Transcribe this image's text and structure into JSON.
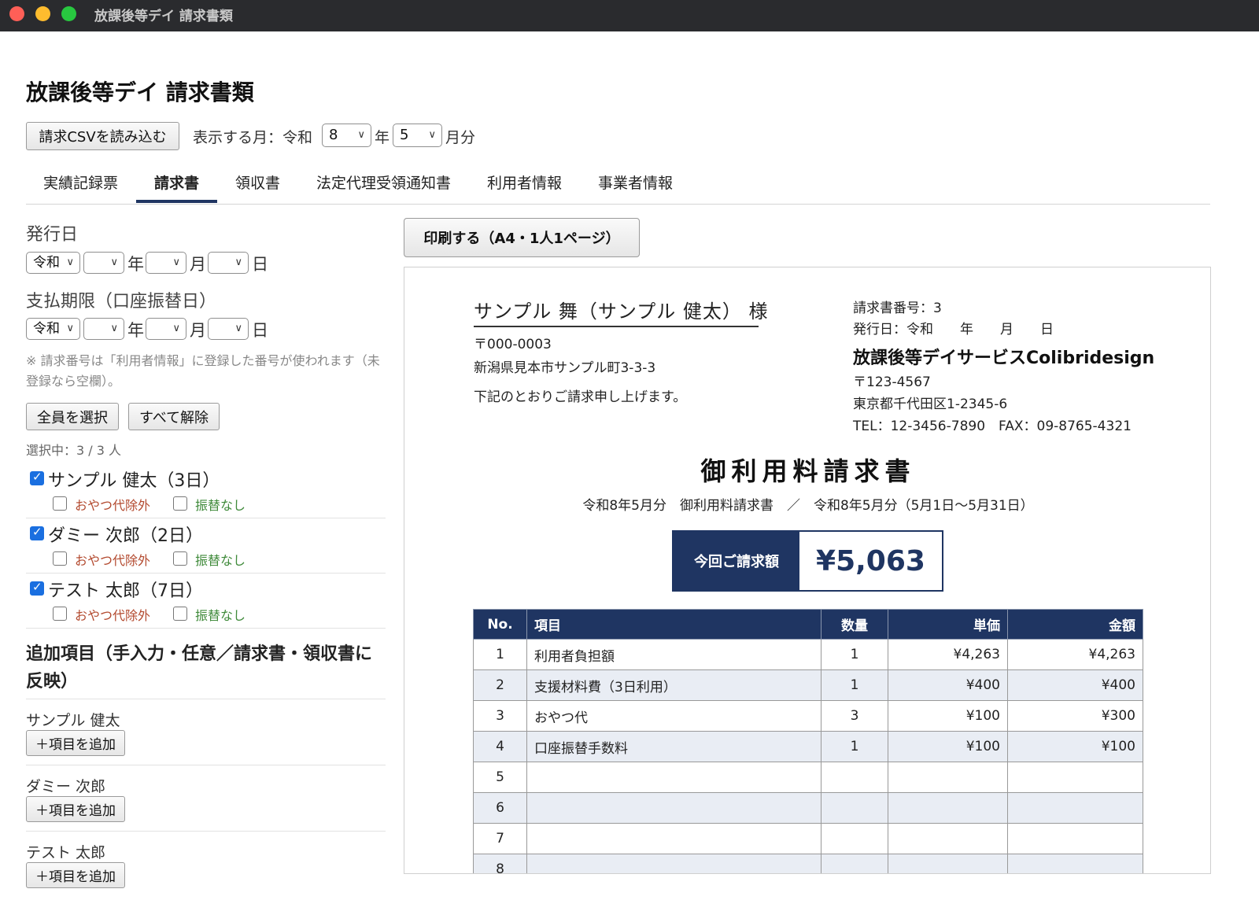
{
  "window": {
    "title": "放課後等デイ 請求書類"
  },
  "page": {
    "title": "放課後等デイ 請求書類"
  },
  "toolbar": {
    "csv_button": "請求CSVを読み込む",
    "month_label_pre": "表示する月：令和",
    "year_value": "8",
    "year_suffix": "年",
    "month_value": "5",
    "month_suffix": "月分"
  },
  "tabs": [
    "実績記録票",
    "請求書",
    "領収書",
    "法定代理受領通知書",
    "利用者情報",
    "事業者情報"
  ],
  "active_tab": "請求書",
  "issue_date": {
    "label": "発行日",
    "era": "令和",
    "year": "",
    "month": "",
    "day": "",
    "year_unit": "年",
    "month_unit": "月",
    "day_unit": "日"
  },
  "due_date": {
    "label": "支払期限（口座振替日）",
    "era": "令和",
    "year": "",
    "month": "",
    "day": "",
    "year_unit": "年",
    "month_unit": "月",
    "day_unit": "日"
  },
  "note": "※ 請求番号は「利用者情報」に登録した番号が使われます（未登録なら空欄）。",
  "select_all_button": "全員を選択",
  "deselect_all_button": "すべて解除",
  "selection_status": "選択中：3 / 3 人",
  "persons": [
    {
      "name": "サンプル 健太（3日）",
      "checked": true,
      "opt1": "おやつ代除外",
      "opt2": "振替なし"
    },
    {
      "name": "ダミー 次郎（2日）",
      "checked": true,
      "opt1": "おやつ代除外",
      "opt2": "振替なし"
    },
    {
      "name": "テスト 太郎（7日）",
      "checked": true,
      "opt1": "おやつ代除外",
      "opt2": "振替なし"
    }
  ],
  "additional": {
    "title": "追加項目（手入力・任意／請求書・領収書に反映）",
    "users": [
      {
        "name": "サンプル 健太",
        "button": "＋項目を追加"
      },
      {
        "name": "ダミー 次郎",
        "button": "＋項目を追加"
      },
      {
        "name": "テスト 太郎",
        "button": "＋項目を追加"
      }
    ]
  },
  "print_button": "印刷する（A4・1人1ページ）",
  "invoice": {
    "recipient": "サンプル 舞（サンプル 健太） 様",
    "postal": "〒000-0003",
    "address": "新潟県見本市サンプル町3-3-3",
    "greeting": "下記のとおりご請求申し上げます。",
    "invoice_number": "請求書番号：3",
    "issue_date": "発行日：令和　　年　　月　　日",
    "issuer_name": "放課後等デイサービスColibridesign",
    "issuer_postal": "〒123-4567",
    "issuer_address": "東京都千代田区1-2345-6",
    "issuer_contact": "TEL：12-3456-7890　FAX：09-8765-4321",
    "title": "御利用料請求書",
    "subtitle": "令和8年5月分　御利用料請求書　／　令和8年5月分（5月1日〜5月31日）",
    "total_label": "今回ご請求額",
    "total_value": "¥5,063",
    "table": {
      "headers": [
        "No.",
        "項目",
        "数量",
        "単価",
        "金額"
      ],
      "rows": [
        [
          "1",
          "利用者負担額",
          "1",
          "¥4,263",
          "¥4,263"
        ],
        [
          "2",
          "支援材料費（3日利用）",
          "1",
          "¥400",
          "¥400"
        ],
        [
          "3",
          "おやつ代",
          "3",
          "¥100",
          "¥300"
        ],
        [
          "4",
          "口座振替手数料",
          "1",
          "¥100",
          "¥100"
        ],
        [
          "5",
          "",
          "",
          "",
          ""
        ],
        [
          "6",
          "",
          "",
          "",
          ""
        ],
        [
          "7",
          "",
          "",
          "",
          ""
        ],
        [
          "8",
          "",
          "",
          "",
          ""
        ]
      ]
    }
  }
}
